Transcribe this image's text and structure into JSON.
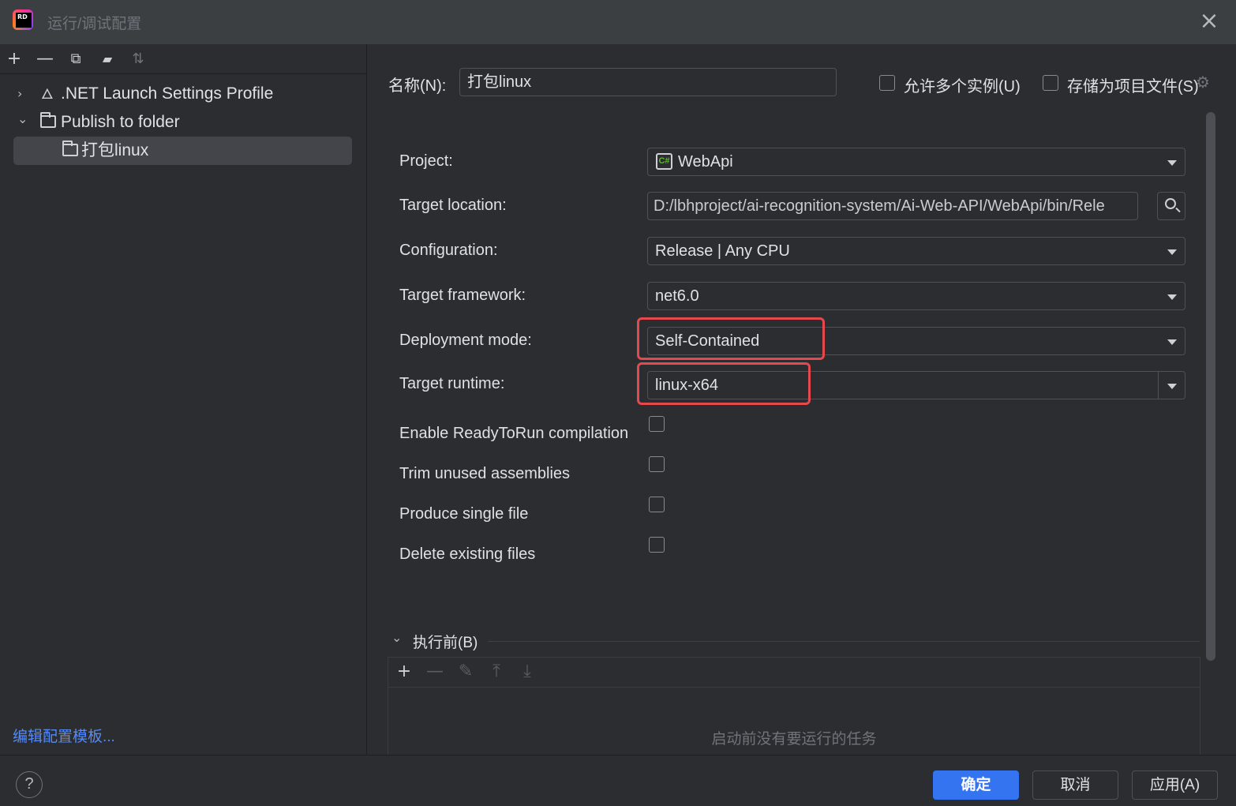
{
  "window": {
    "title": "运行/调试配置"
  },
  "left_toolbar": {
    "add": "+",
    "remove": "—",
    "copy": "⧉",
    "folder": "▰",
    "sort": "⇅"
  },
  "tree": {
    "items": [
      {
        "label": ".NET Launch Settings Profile",
        "arrow": "›"
      },
      {
        "label": "Publish to folder",
        "arrow": "⌄"
      },
      {
        "label": "打包linux"
      }
    ]
  },
  "edit_templates_link": "编辑配置模板...",
  "header": {
    "name_label": "名称(N):",
    "name_value": "打包linux",
    "allow_parallel_label": "允许多个实例(U)",
    "store_as_project_file_label": "存储为项目文件(S)"
  },
  "form": {
    "project": {
      "label": "Project:",
      "value": "WebApi"
    },
    "target_location": {
      "label": "Target location:",
      "value": "D:/lbhproject/ai-recognition-system/Ai-Web-API/WebApi/bin/Rele"
    },
    "configuration": {
      "label": "Configuration:",
      "value": "Release | Any CPU"
    },
    "target_framework": {
      "label": "Target framework:",
      "value": "net6.0"
    },
    "deployment_mode": {
      "label": "Deployment mode:",
      "value": "Self-Contained"
    },
    "target_runtime": {
      "label": "Target runtime:",
      "value": "linux-x64"
    },
    "checkboxes": [
      {
        "label": "Enable ReadyToRun compilation",
        "checked": false
      },
      {
        "label": "Trim unused assemblies",
        "checked": false
      },
      {
        "label": "Produce single file",
        "checked": false
      },
      {
        "label": "Delete existing files",
        "checked": false
      }
    ]
  },
  "before_launch": {
    "title": "执行前(B)",
    "empty_text": "启动前没有要运行的任务",
    "toolbar": {
      "add": "+",
      "remove": "—",
      "edit": "✎",
      "up": "⤒",
      "down": "⤓"
    }
  },
  "buttons": {
    "help": "?",
    "ok": "确定",
    "cancel": "取消",
    "apply": "应用(A)"
  },
  "colors": {
    "accent": "#3574f0",
    "highlight": "#e5484d",
    "link": "#548af7",
    "background": "#2b2d30"
  }
}
